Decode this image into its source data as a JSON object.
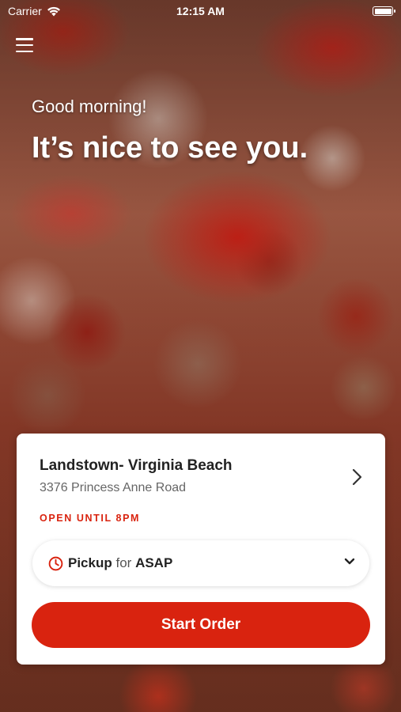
{
  "status_bar": {
    "carrier": "Carrier",
    "time": "12:15 AM",
    "battery_level": 1.0,
    "icons": [
      "wifi-icon",
      "battery-icon"
    ]
  },
  "header": {
    "menu_icon": "hamburger-menu-icon",
    "greeting": "Good morning!",
    "headline": "It’s nice to see you."
  },
  "location": {
    "name": "Landstown- Virginia Beach",
    "address": "3376 Princess Anne Road",
    "status": "OPEN UNTIL 8PM",
    "icon": "chevron-right-icon"
  },
  "order_type": {
    "mode": "Pickup",
    "connector": "for",
    "time": "ASAP",
    "icons": [
      "clock-icon",
      "chevron-down-icon"
    ]
  },
  "actions": {
    "start_order_label": "Start Order"
  },
  "colors": {
    "accent": "#d9230f",
    "card_background": "#ffffff",
    "text_primary": "#222222",
    "text_secondary": "#666666"
  }
}
